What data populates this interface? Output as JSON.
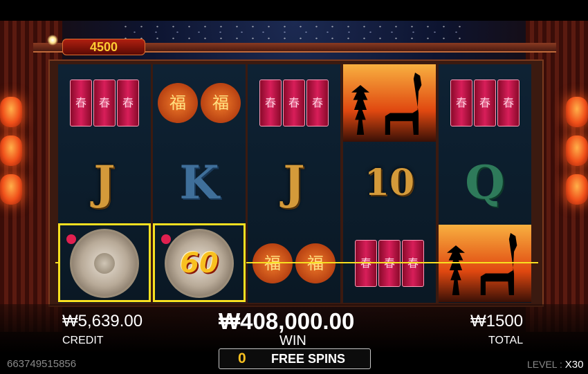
{
  "top_counter": "4500",
  "reels": [
    [
      "firecrackers",
      "J",
      "gong"
    ],
    [
      "lanterns",
      "K",
      "gong-60"
    ],
    [
      "firecrackers",
      "J",
      "lanterns"
    ],
    [
      "alpaca-sunset",
      "10",
      "firecrackers"
    ],
    [
      "firecrackers",
      "Q",
      "alpaca-sunset"
    ]
  ],
  "symbol_text": {
    "firecracker_char": "春",
    "lantern_char": "福",
    "J": "J",
    "K": "K",
    "Q": "Q",
    "ten": "10",
    "gong_multiplier": "60"
  },
  "highlight_color": "#f8e020",
  "credit": {
    "value": "₩5,639.00",
    "label": "CREDIT"
  },
  "win": {
    "value": "₩408,000.00",
    "label": "WIN"
  },
  "total": {
    "value": "₩1500",
    "label": "TOTAL"
  },
  "free_spins": {
    "count": "0",
    "label": "FREE SPINS"
  },
  "game_id": "663749515856",
  "level": {
    "label": "LEVEL :",
    "value": "X30"
  }
}
